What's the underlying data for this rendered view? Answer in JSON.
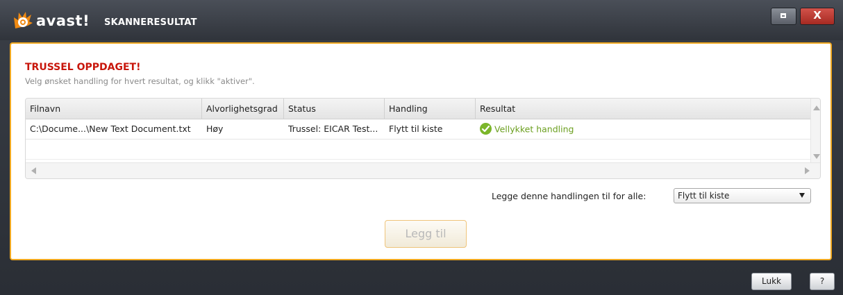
{
  "app": {
    "logo_text": "avast!",
    "title": "SKANNERESULTAT"
  },
  "window_controls": {
    "close_label": "X"
  },
  "panel": {
    "heading": "TRUSSEL OPPDAGET!",
    "subheading": "Velg ønsket handling for hvert resultat, og klikk \"aktiver\"."
  },
  "table": {
    "columns": [
      "Filnavn",
      "Alvorlighetsgrad",
      "Status",
      "Handling",
      "Resultat"
    ],
    "rows": [
      {
        "filename": "C:\\Docume...\\New Text Document.txt",
        "severity": "Høy",
        "status": "Trussel: EICAR Test...",
        "action": "Flytt til kiste",
        "result": "Vellykket handling",
        "result_icon": "check-circle-icon"
      }
    ]
  },
  "apply_all": {
    "label": "Legge denne handlingen til for alle:",
    "selected": "Flytt til kiste"
  },
  "buttons": {
    "apply": "Legg til",
    "close": "Lukk",
    "help": "?"
  },
  "colors": {
    "accent": "#f0a820",
    "danger": "#c8160b",
    "success": "#7bb62a"
  }
}
